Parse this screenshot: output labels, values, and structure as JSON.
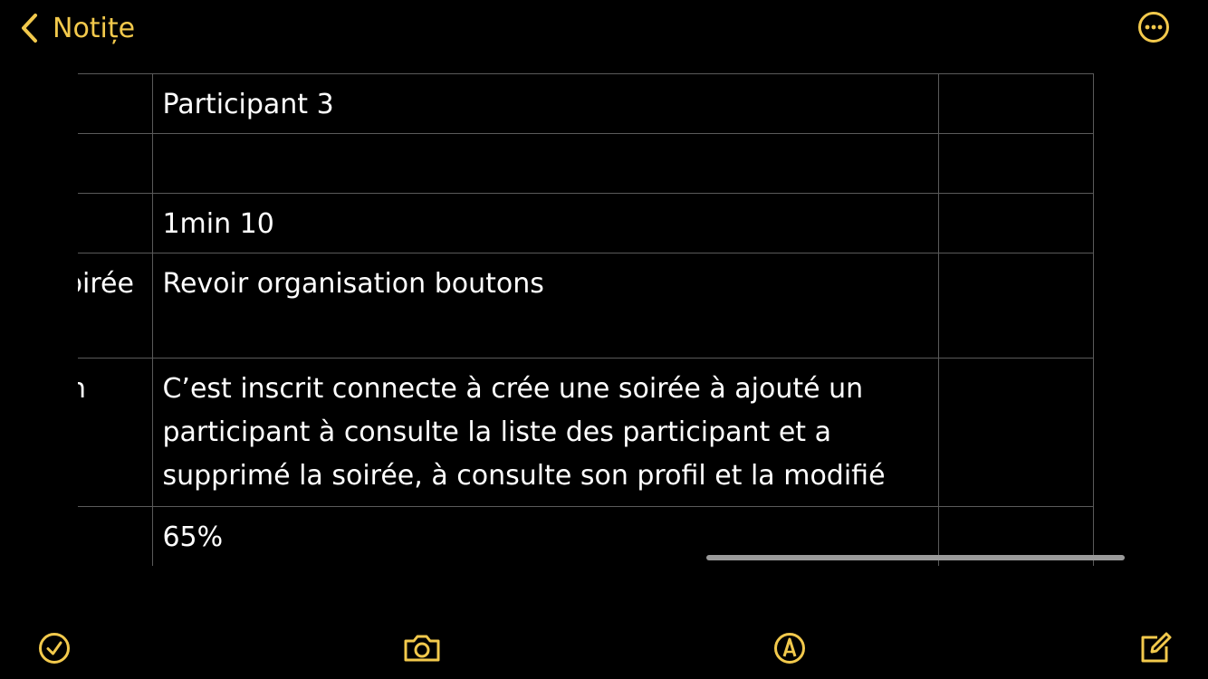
{
  "header": {
    "back_label": "Notițe"
  },
  "colors": {
    "accent": "#f2c94c",
    "background": "#000000",
    "grid": "#5a5a5a"
  },
  "table": {
    "rows": [
      {
        "col1": "",
        "col2": "Participant 3",
        "col3": ""
      },
      {
        "col1": "",
        "col2": "",
        "col3": ""
      },
      {
        "col1": "",
        "col2": "1min 10",
        "col3": ""
      },
      {
        "col1": "soirée",
        "col2": "Revoir organisation boutons",
        "col3": ""
      },
      {
        "col1": "un",
        "col2": "C’est inscrit connecte à crée une soirée à ajouté un participant à consulte la liste des participant et a supprimé la soirée, à consulte son profil et la modifié",
        "col3": ""
      },
      {
        "col1": "",
        "col2": "65%",
        "col3": ""
      }
    ]
  },
  "toolbar": {
    "icons": [
      "checkmark-icon",
      "camera-icon",
      "markup-pen-icon",
      "compose-icon"
    ]
  }
}
